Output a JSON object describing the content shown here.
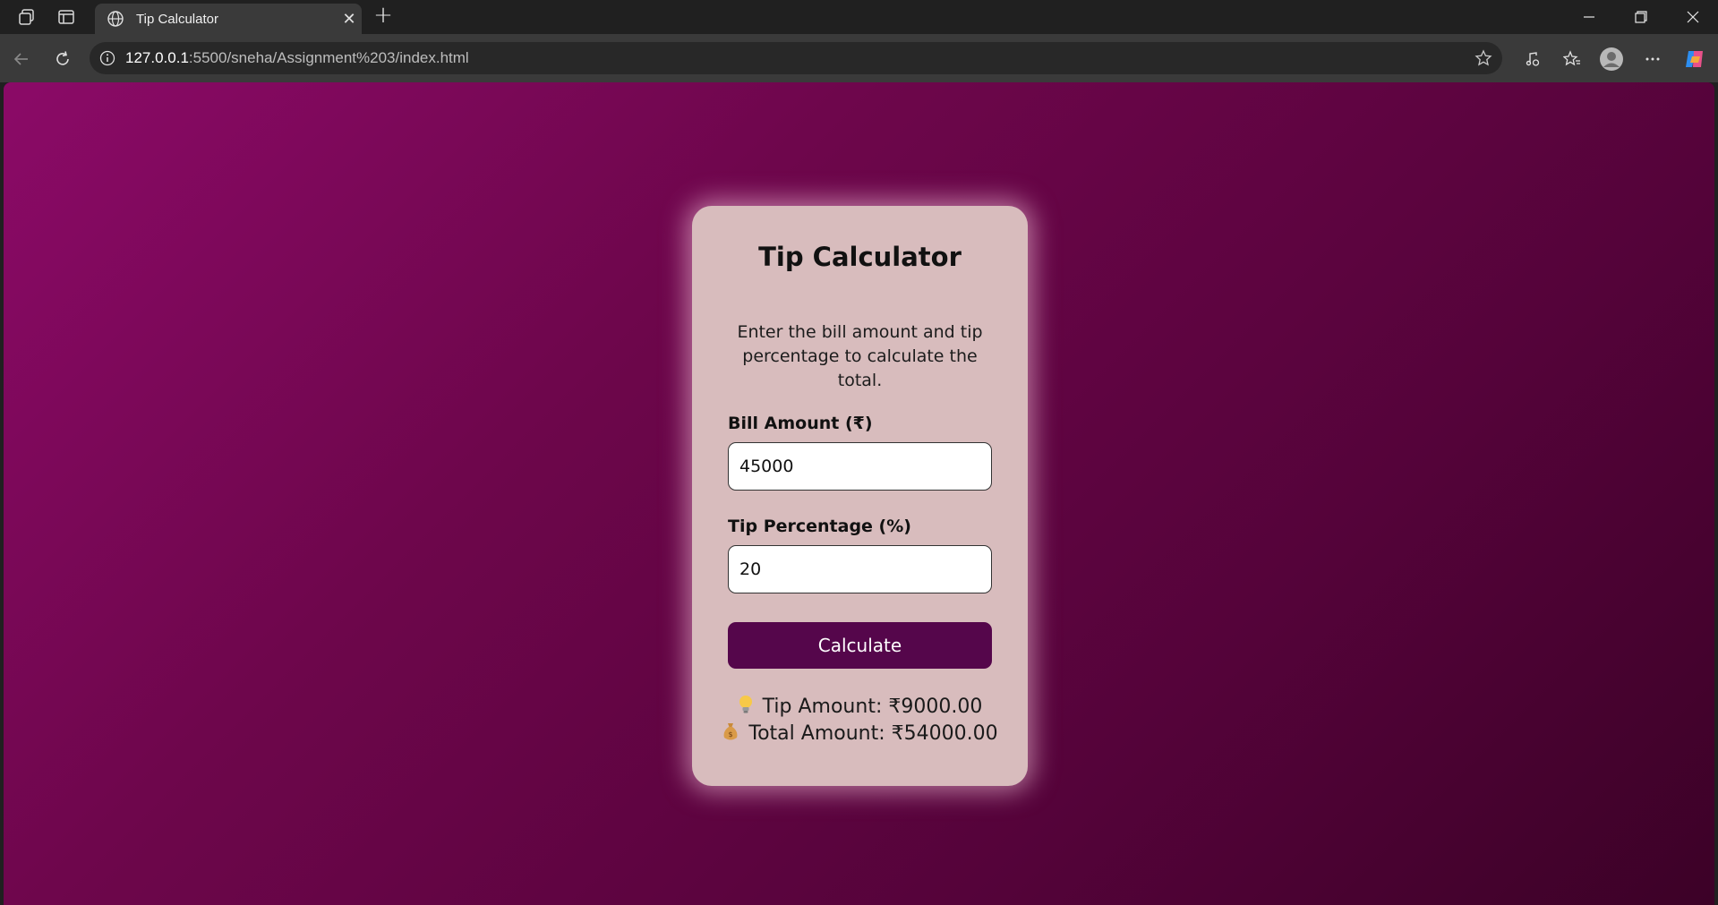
{
  "browser": {
    "tab_title": "Tip Calculator",
    "url_host": "127.0.0.1",
    "url_rest": ":5500/sneha/Assignment%203/index.html"
  },
  "app": {
    "title": "Tip Calculator",
    "description": "Enter the bill amount and tip percentage to calculate the total.",
    "bill_label": "Bill Amount (₹)",
    "bill_value": "45000",
    "tip_label": "Tip Percentage (%)",
    "tip_value": "20",
    "button_label": "Calculate",
    "tip_result": "Tip Amount: ₹9000.00",
    "total_result": "Total Amount: ₹54000.00",
    "tip_icon": "lightbulb-icon",
    "total_icon": "money-bag-icon"
  },
  "colors": {
    "card_background": "#d8bcbd",
    "button_background": "#55064b",
    "gradient_start": "#8b0a67",
    "gradient_end": "#3c0127"
  }
}
